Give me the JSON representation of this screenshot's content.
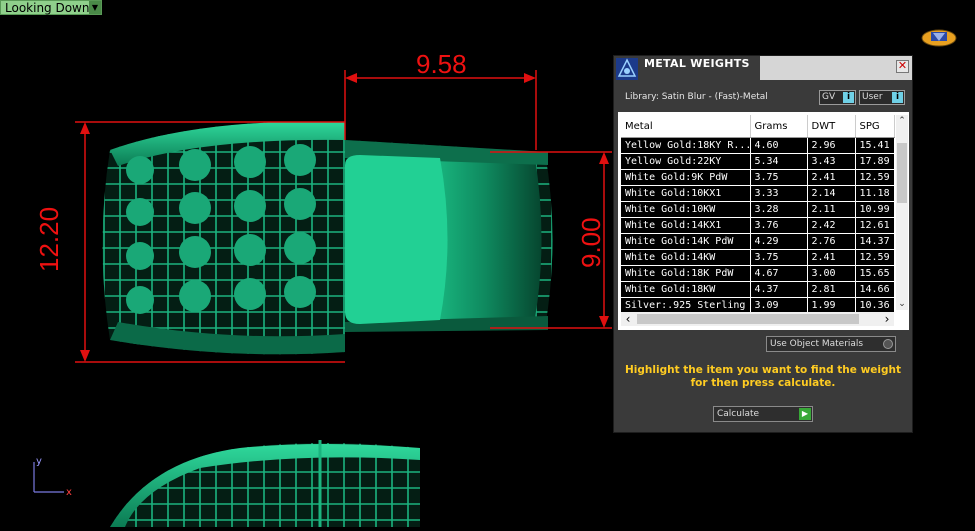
{
  "viewport": {
    "view_label": "Looking Down",
    "dimensions": {
      "top": "9.58",
      "left": "12.20",
      "right": "9.00"
    },
    "axis": {
      "y": "y",
      "x": "x"
    },
    "colors": {
      "metal": "#16a777",
      "dimension": "#e01010",
      "background": "#000000"
    }
  },
  "panel": {
    "title": "METAL WEIGHTS",
    "library": "Library: Satin Blur - (Fast)-Metal",
    "gv_label": "GV",
    "user_label": "User",
    "toggle_icon": "i",
    "columns": [
      "Metal",
      "Grams",
      "DWT",
      "SPG"
    ],
    "rows": [
      [
        "Yellow Gold:18KY R...",
        "4.60",
        "2.96",
        "15.41"
      ],
      [
        "Yellow Gold:22KY",
        "5.34",
        "3.43",
        "17.89"
      ],
      [
        "White Gold:9K PdW",
        "3.75",
        "2.41",
        "12.59"
      ],
      [
        "White Gold:10KX1",
        "3.33",
        "2.14",
        "11.18"
      ],
      [
        "White Gold:10KW",
        "3.28",
        "2.11",
        "10.99"
      ],
      [
        "White Gold:14KX1",
        "3.76",
        "2.42",
        "12.61"
      ],
      [
        "White Gold:14K PdW",
        "4.29",
        "2.76",
        "14.37"
      ],
      [
        "White Gold:14KW",
        "3.75",
        "2.41",
        "12.59"
      ],
      [
        "White Gold:18K PdW",
        "4.67",
        "3.00",
        "15.65"
      ],
      [
        "White Gold:18KW",
        "4.37",
        "2.81",
        "14.66"
      ],
      [
        "Silver:.925 Sterling",
        "3.09",
        "1.99",
        "10.36"
      ]
    ],
    "use_object_materials": "Use Object Materials",
    "instruction": "Highlight the item you want to find the weight for then press calculate.",
    "calculate_label": "Calculate",
    "colors": {
      "instruction": "#ffcc22",
      "accent": "#6fd0e6",
      "go": "#38a838"
    }
  }
}
